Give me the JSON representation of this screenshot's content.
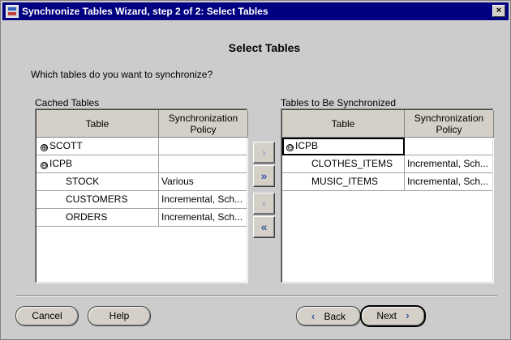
{
  "window": {
    "title": "Synchronize Tables Wizard, step 2 of 2: Select Tables",
    "close_label": "×"
  },
  "heading": "Select Tables",
  "question": "Which tables do you want to synchronize?",
  "cached": {
    "label": "Cached Tables",
    "columns": [
      "Table",
      "Synchronization Policy"
    ],
    "rows": [
      {
        "toggle": "⊕",
        "name": "SCOTT",
        "policy": ""
      },
      {
        "toggle": "⊖",
        "name": "ICPB",
        "policy": ""
      },
      {
        "toggle": "",
        "name": "STOCK",
        "policy": "Various"
      },
      {
        "toggle": "",
        "name": "CUSTOMERS",
        "policy": "Incremental, Sch..."
      },
      {
        "toggle": "",
        "name": "ORDERS",
        "policy": "Incremental, Sch..."
      }
    ]
  },
  "sync": {
    "label": "Tables to Be Synchronized",
    "columns": [
      "Table",
      "Synchronization Policy"
    ],
    "rows": [
      {
        "toggle": "⊖",
        "name": "ICPB",
        "policy": ""
      },
      {
        "toggle": "",
        "name": "CLOTHES_ITEMS",
        "policy": "Incremental, Sch..."
      },
      {
        "toggle": "",
        "name": "MUSIC_ITEMS",
        "policy": "Incremental, Sch..."
      }
    ]
  },
  "move_buttons": {
    "add": "›",
    "add_all": "»",
    "remove": "‹",
    "remove_all": "«"
  },
  "footer": {
    "cancel": "Cancel",
    "help": "Help",
    "back": "Back",
    "next": "Next",
    "back_arrow": "‹",
    "next_arrow": "›"
  }
}
